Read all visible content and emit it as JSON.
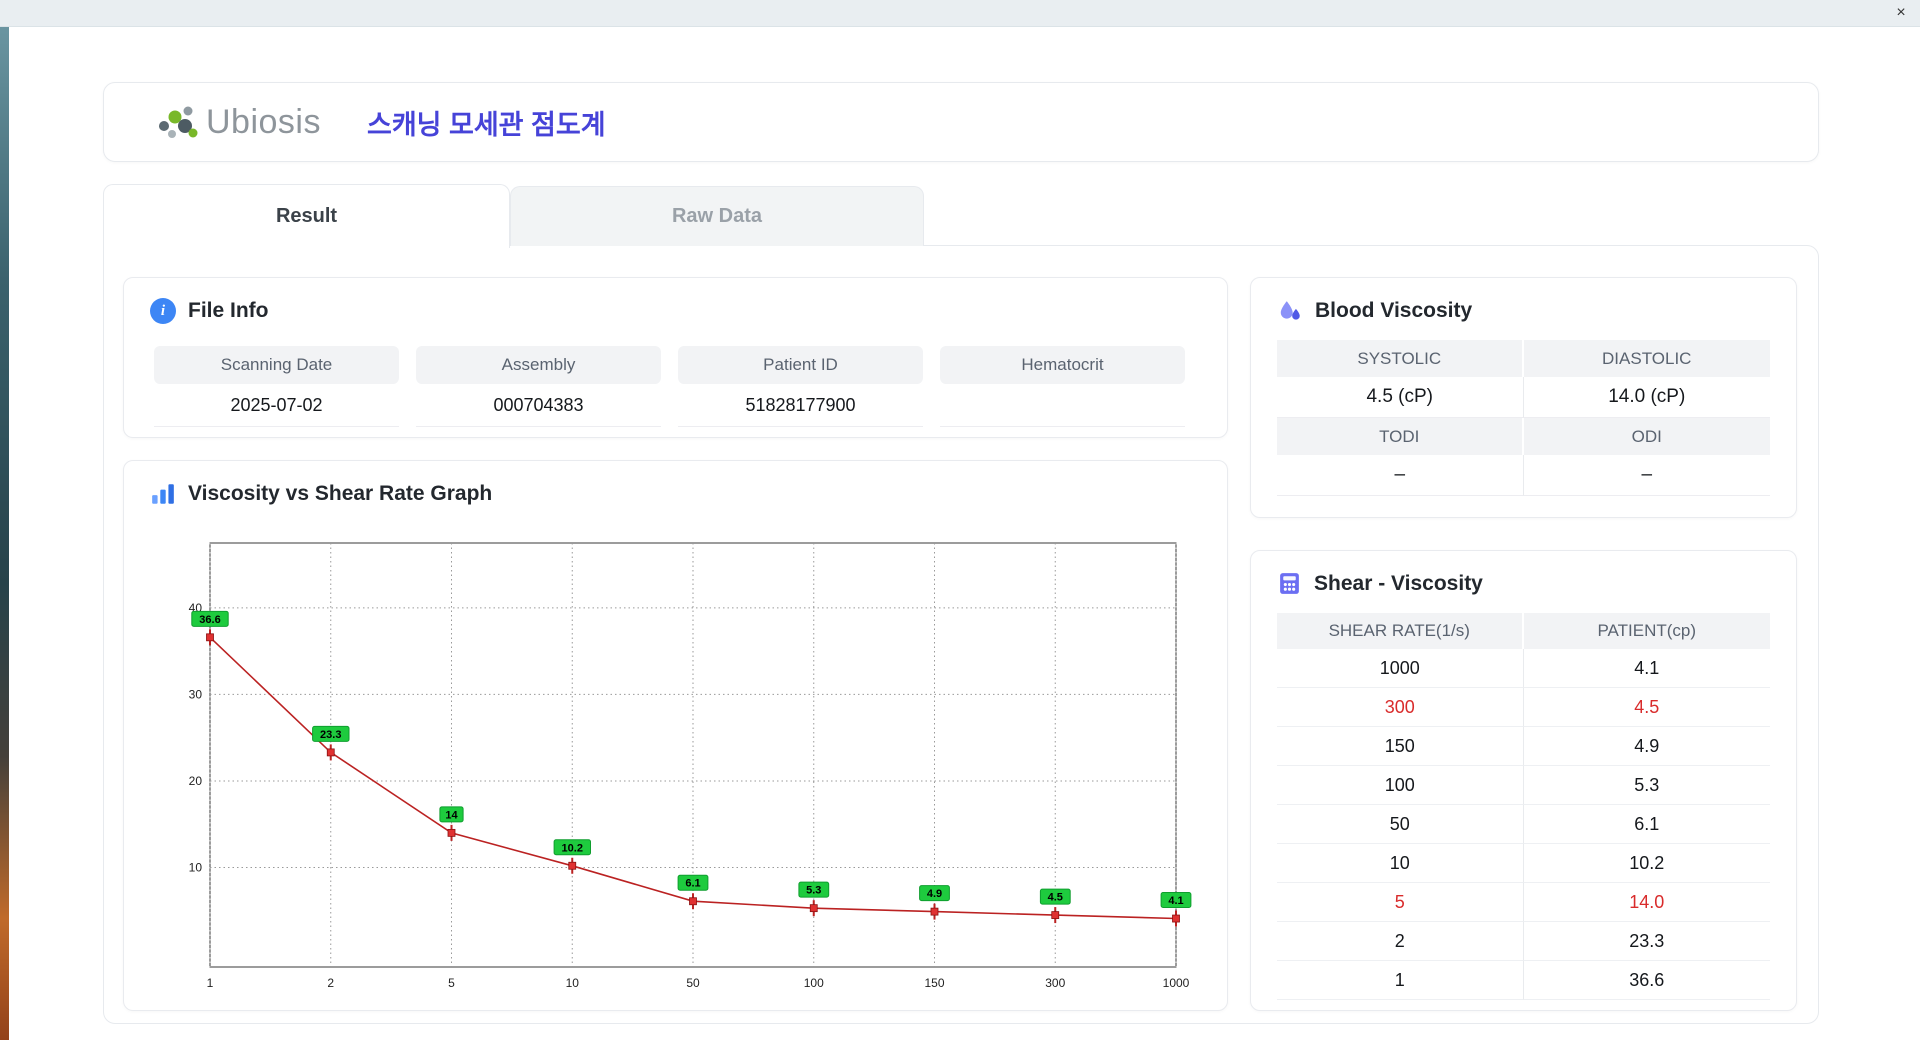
{
  "window": {
    "close_label": "×"
  },
  "header": {
    "logo_text": "Ubiosis",
    "app_title": "스캐닝 모세관 점도계",
    "title_color": "#4643d8"
  },
  "tabs": [
    {
      "label": "Result",
      "active": true
    },
    {
      "label": "Raw Data",
      "active": false
    }
  ],
  "file_info": {
    "title": "File Info",
    "fields": [
      {
        "label": "Scanning Date",
        "value": "2025-07-02"
      },
      {
        "label": "Assembly",
        "value": "000704383"
      },
      {
        "label": "Patient ID",
        "value": "51828177900"
      },
      {
        "label": "Hematocrit",
        "value": ""
      }
    ]
  },
  "blood_viscosity": {
    "title": "Blood Viscosity",
    "cells": [
      {
        "label": "SYSTOLIC",
        "value": "4.5 (cP)"
      },
      {
        "label": "DIASTOLIC",
        "value": "14.0 (cP)"
      },
      {
        "label": "TODI",
        "value": "–"
      },
      {
        "label": "ODI",
        "value": "–"
      }
    ]
  },
  "graph": {
    "title": "Viscosity vs Shear Rate Graph"
  },
  "chart_data": {
    "type": "line",
    "title": "Viscosity vs Shear Rate Graph",
    "categories": [
      "1",
      "2",
      "5",
      "10",
      "50",
      "100",
      "150",
      "300",
      "1000"
    ],
    "values": [
      36.6,
      23.3,
      14,
      10.2,
      6.1,
      5.3,
      4.9,
      4.5,
      4.1
    ],
    "point_labels": [
      "36.6",
      "23.3",
      "14",
      "10.2",
      "6.1",
      "5.3",
      "4.9",
      "4.5",
      "4.1"
    ],
    "yticks": [
      10,
      20,
      30,
      40
    ],
    "ylim": [
      -1.5,
      47.5
    ],
    "x_scale": "categorical",
    "grid": true,
    "legend": false,
    "line_color": "#bb2222",
    "marker_color": "#e03131",
    "marker_edge": "#8a1111",
    "label_bg": "#1ecb3e",
    "label_border": "#0f9e2e",
    "label_text_color": "#000000"
  },
  "shear_table": {
    "title": "Shear - Viscosity",
    "columns": [
      "SHEAR RATE(1/s)",
      "PATIENT(cp)"
    ],
    "highlight_color": "#d92b2b",
    "rows": [
      {
        "shear": "1000",
        "patient": "4.1",
        "highlight": false
      },
      {
        "shear": "300",
        "patient": "4.5",
        "highlight": true
      },
      {
        "shear": "150",
        "patient": "4.9",
        "highlight": false
      },
      {
        "shear": "100",
        "patient": "5.3",
        "highlight": false
      },
      {
        "shear": "50",
        "patient": "6.1",
        "highlight": false
      },
      {
        "shear": "10",
        "patient": "10.2",
        "highlight": false
      },
      {
        "shear": "5",
        "patient": "14.0",
        "highlight": true
      },
      {
        "shear": "2",
        "patient": "23.3",
        "highlight": false
      },
      {
        "shear": "1",
        "patient": "36.6",
        "highlight": false
      }
    ]
  }
}
